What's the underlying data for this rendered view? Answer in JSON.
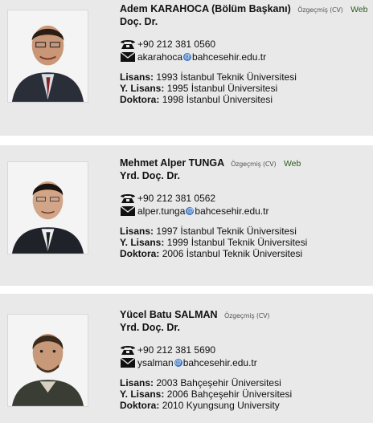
{
  "labels": {
    "cv": "Özgeçmiş (CV)",
    "web": "Web"
  },
  "people": [
    {
      "name": "Adem KARAHOCA (Bölüm Başkanı)",
      "title": "Doç. Dr.",
      "phone": "+90 212 381 0560",
      "email_user": "akarahoca",
      "email_domain": "bahcesehir.edu.tr",
      "has_web": true,
      "edu": [
        {
          "label": "Lisans:",
          "value": "1993 İstanbul Teknik Üniversitesi"
        },
        {
          "label": "Y. Lisans:",
          "value": "1995 İstanbul Üniversitesi"
        },
        {
          "label": "Doktora:",
          "value": "1998 İstanbul Üniversitesi"
        }
      ]
    },
    {
      "name": "Mehmet Alper TUNGA",
      "title": "Yrd. Doç. Dr.",
      "phone": "+90 212 381 0562",
      "email_user": "alper.tunga",
      "email_domain": "bahcesehir.edu.tr",
      "has_web": true,
      "edu": [
        {
          "label": "Lisans:",
          "value": "1997 İstanbul Teknik Üniversitesi"
        },
        {
          "label": "Y. Lisans:",
          "value": "1999 İstanbul Teknik Üniversitesi"
        },
        {
          "label": "Doktora:",
          "value": "2006 İstanbul Teknik Üniversitesi"
        }
      ]
    },
    {
      "name": "Yücel Batu SALMAN",
      "title": "Yrd. Doç. Dr.",
      "phone": "+90 212 381 5690",
      "email_user": "ysalman",
      "email_domain": "bahcesehir.edu.tr",
      "has_web": false,
      "edu": [
        {
          "label": "Lisans:",
          "value": "2003 Bahçeşehir Üniversitesi"
        },
        {
          "label": "Y. Lisans:",
          "value": "2006 Bahçeşehir Üniversitesi"
        },
        {
          "label": "Doktora:",
          "value": "2010 Kyungsung University"
        }
      ]
    }
  ],
  "colors": {
    "card_bg": "#e9e9e9",
    "web_link": "#2c5b19",
    "at_badge": "#3a74c4"
  }
}
